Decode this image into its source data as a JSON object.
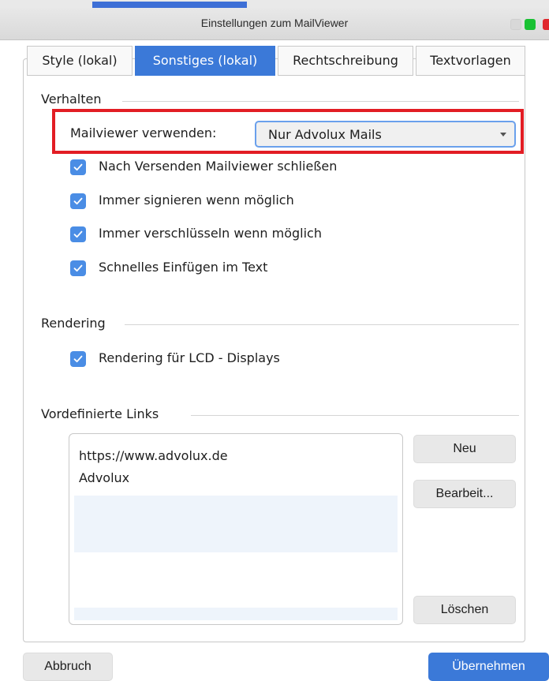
{
  "window": {
    "title": "Einstellungen zum MailViewer"
  },
  "tabs": [
    {
      "label": "Style (lokal)",
      "active": false
    },
    {
      "label": "Sonstiges (lokal)",
      "active": true
    },
    {
      "label": "Rechtschreibung",
      "active": false
    },
    {
      "label": "Textvorlagen",
      "active": false
    }
  ],
  "verhalten": {
    "label": "Verhalten",
    "mailviewer_label": "Mailviewer verwenden:",
    "mailviewer_value": "Nur Advolux Mails",
    "checkboxes": [
      {
        "label": "Nach Versenden Mailviewer schließen",
        "checked": true
      },
      {
        "label": "Immer signieren wenn möglich",
        "checked": true
      },
      {
        "label": "Immer verschlüsseln wenn möglich",
        "checked": true
      },
      {
        "label": "Schnelles Einfügen im Text",
        "checked": true
      }
    ]
  },
  "rendering": {
    "label": "Rendering",
    "checkboxes": [
      {
        "label": "Rendering für LCD - Displays",
        "checked": true
      }
    ]
  },
  "links": {
    "label": "Vordefinierte Links",
    "items": [
      "https://www.advolux.de",
      "Advolux"
    ],
    "new_label": "Neu",
    "edit_label": "Bearbeit...",
    "delete_label": "Löschen"
  },
  "footer": {
    "cancel_label": "Abbruch",
    "apply_label": "Übernehmen"
  },
  "colors": {
    "accent": "#3b79d8",
    "checkbox": "#4a8de5",
    "highlight": "#e21d24",
    "traffic_green": "#19c133",
    "traffic_red": "#e0282d"
  }
}
